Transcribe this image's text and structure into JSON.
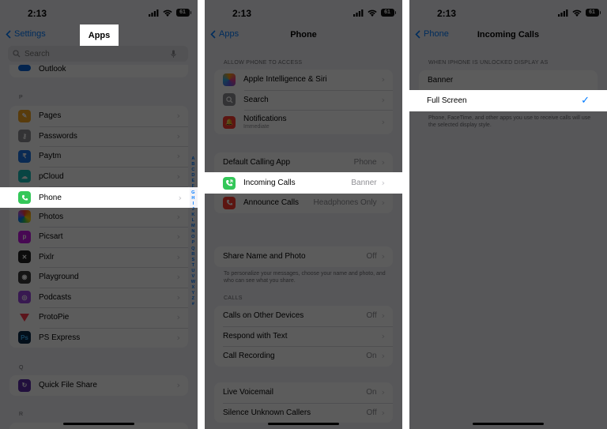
{
  "status": {
    "time": "2:13",
    "battery": "61"
  },
  "panel1": {
    "title": "Apps",
    "back": "Settings",
    "search_placeholder": "Search",
    "partial_item": "Outlook",
    "section_p": "P",
    "section_q": "Q",
    "section_r": "R",
    "items": [
      {
        "label": "Pages",
        "color": "#f5a623"
      },
      {
        "label": "Passwords",
        "color": "#8e8e93"
      },
      {
        "label": "Paytm",
        "color": "#1c74e5"
      },
      {
        "label": "pCloud",
        "color": "#17bebb"
      },
      {
        "label": "Phone",
        "color": "#34c759"
      },
      {
        "label": "Photos",
        "color": "#ff9f0a"
      },
      {
        "label": "Picsart",
        "color": "#c517e5"
      },
      {
        "label": "Pixlr",
        "color": "#222222"
      },
      {
        "label": "Playground",
        "color": "#3a3a3c"
      },
      {
        "label": "Podcasts",
        "color": "#9b45e0"
      },
      {
        "label": "ProtoPie",
        "color": "#ff3b4e"
      },
      {
        "label": "PS Express",
        "color": "#0b2a4a"
      }
    ],
    "quick_file_share": "Quick File Share",
    "ps_glyph": "Ps",
    "index_letters": [
      "A",
      "B",
      "C",
      "D",
      "E",
      "F",
      "G",
      "H",
      "I",
      "J",
      "K",
      "L",
      "M",
      "N",
      "O",
      "P",
      "Q",
      "R",
      "S",
      "T",
      "U",
      "V",
      "W",
      "X",
      "Y",
      "Z",
      "#"
    ]
  },
  "panel2": {
    "back": "Apps",
    "title": "Phone",
    "allow_header": "ALLOW PHONE TO ACCESS",
    "access_items": [
      {
        "label": "Apple Intelligence & Siri",
        "color": "#e7408c"
      },
      {
        "label": "Search",
        "color": "#8e8e93"
      },
      {
        "label": "Notifications",
        "sub": "Immediate",
        "color": "#ff3b30"
      }
    ],
    "default_calling": {
      "label": "Default Calling App",
      "value": "Phone"
    },
    "incoming_calls": {
      "label": "Incoming Calls",
      "value": "Banner"
    },
    "announce_calls": {
      "label": "Announce Calls",
      "value": "Headphones Only"
    },
    "share_name": {
      "label": "Share Name and Photo",
      "value": "Off"
    },
    "share_note": "To personalize your messages, choose your name and photo, and who can see what you share.",
    "calls_header": "CALLS",
    "calls_items": [
      {
        "label": "Calls on Other Devices",
        "value": "Off"
      },
      {
        "label": "Respond with Text",
        "value": ""
      },
      {
        "label": "Call Recording",
        "value": "On"
      }
    ],
    "live_voicemail": {
      "label": "Live Voicemail",
      "value": "On"
    },
    "silence_unknown": {
      "label": "Silence Unknown Callers",
      "value": "Off"
    }
  },
  "panel3": {
    "back": "Phone",
    "title": "Incoming Calls",
    "header": "WHEN IPHONE IS UNLOCKED DISPLAY AS",
    "options": [
      {
        "label": "Banner"
      },
      {
        "label": "Full Screen"
      }
    ],
    "footnote": "Phone, FaceTime, and other apps you use to receive calls will use the selected display style."
  },
  "colors": {
    "accent": "#007aff",
    "phone_green": "#34c759"
  }
}
